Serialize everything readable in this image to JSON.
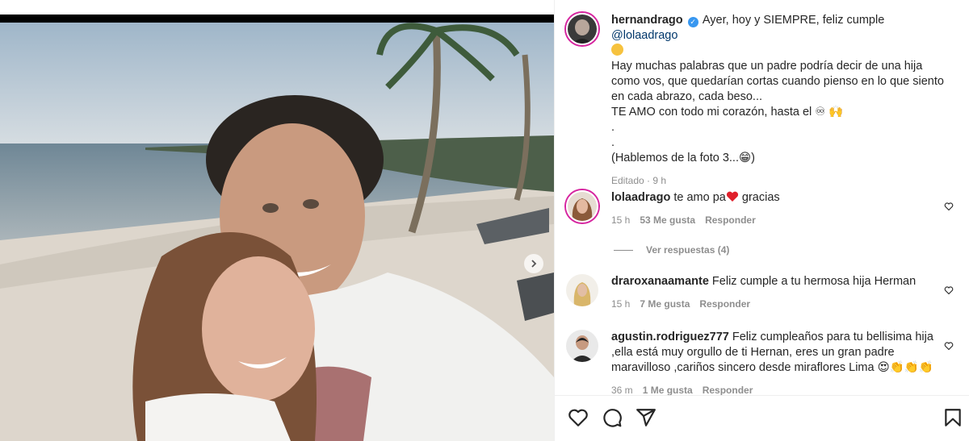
{
  "post": {
    "username": "hernandrago",
    "caption_line1_pre": "Ayer, hoy y SIEMPRE, feliz cumple ",
    "mention": "@lolaadrago",
    "caption_lines": [
      "Hay muchas palabras que un padre podría decir de una hija",
      "como vos, que quedarían cortas cuando pienso en lo que siento",
      "en cada abrazo, cada beso...",
      "TE AMO con todo mi corazón, hasta el ♾ 🙌",
      ".",
      ".",
      "(Hablemos de la foto 3...😁)"
    ],
    "meta": "Editado · 9 h"
  },
  "comments": [
    {
      "username": "lolaadrago",
      "text_pre": "te amo pa",
      "text_post": " gracias",
      "time": "15 h",
      "likes": "53 Me gusta",
      "reply": "Responder"
    },
    {
      "username": "draroxanaamante",
      "text": "Feliz cumple a tu hermosa hija Herman",
      "time": "15 h",
      "likes": "7 Me gusta",
      "reply": "Responder"
    },
    {
      "username": "agustin.rodriguez777",
      "text_line1": "Feliz cumpleaños para tu bellisima hija",
      "text_line2": ",ella está muy orgullo de ti Hernan, eres un gran padre",
      "text_line3": "maravilloso ,cariños sincero desde miraflores Lima 😍👏👏👏",
      "time": "36 m",
      "likes": "1 Me gusta",
      "reply": "Responder"
    }
  ],
  "view_replies": "Ver respuestas (4)",
  "colors": {
    "link": "#00376b",
    "meta": "#8e8e8e",
    "text": "#262626",
    "verified": "#3897f0",
    "heart": "#ed4956"
  },
  "icons": [
    "heart-icon",
    "comment-icon",
    "share-icon",
    "bookmark-icon",
    "chevron-right-icon",
    "verified-icon"
  ]
}
